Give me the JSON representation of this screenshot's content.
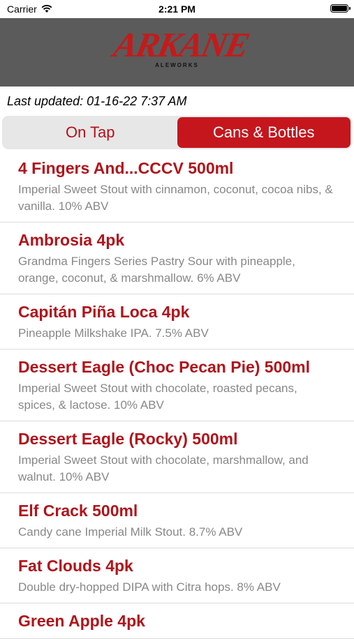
{
  "status": {
    "carrier": "Carrier",
    "time": "2:21 PM"
  },
  "header": {
    "logo_main": "ARKANE",
    "logo_sub": "ALEWORKS"
  },
  "last_updated": "Last updated: 01-16-22 7:37 AM",
  "segments": {
    "on_tap": "On Tap",
    "cans_bottles": "Cans & Bottles",
    "selected": "Cans & Bottles"
  },
  "colors": {
    "accent": "#c5161d",
    "header_bg": "#5b5b5b",
    "title": "#b0141b",
    "desc": "#888888"
  },
  "items": [
    {
      "title": "4 Fingers And...CCCV 500ml",
      "desc": "Imperial Sweet Stout with cinnamon, coconut, cocoa nibs, & vanilla.  10% ABV"
    },
    {
      "title": "Ambrosia 4pk",
      "desc": "Grandma Fingers Series Pastry Sour with pineapple, orange, coconut, & marshmallow.  6% ABV"
    },
    {
      "title": "Capitán Piña Loca 4pk",
      "desc": "Pineapple Milkshake IPA.  7.5% ABV"
    },
    {
      "title": "Dessert Eagle (Choc Pecan Pie) 500ml",
      "desc": "Imperial Sweet Stout with chocolate, roasted pecans, spices, & lactose.  10% ABV"
    },
    {
      "title": "Dessert Eagle (Rocky) 500ml",
      "desc": "Imperial Sweet Stout with chocolate, marshmallow, and walnut.  10% ABV"
    },
    {
      "title": "Elf Crack 500ml",
      "desc": "Candy cane Imperial Milk Stout.  8.7% ABV"
    },
    {
      "title": "Fat Clouds 4pk",
      "desc": "Double dry-hopped DIPA with Citra hops.  8% ABV"
    },
    {
      "title": "Green Apple 4pk",
      "desc": ""
    }
  ]
}
